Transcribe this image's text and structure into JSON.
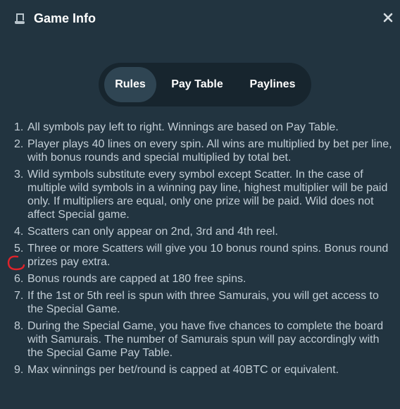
{
  "header": {
    "title": "Game Info",
    "icon": "scroll-icon",
    "close_icon": "close-icon"
  },
  "tabs": [
    {
      "label": "Rules",
      "active": true
    },
    {
      "label": "Pay Table",
      "active": false
    },
    {
      "label": "Paylines",
      "active": false
    }
  ],
  "rules": [
    {
      "num": "1.",
      "text": "All symbols pay left to right. Winnings are based on Pay Table."
    },
    {
      "num": "2.",
      "text": "Player plays 40 lines on every spin. All wins are multiplied by bet per line, with bonus rounds and special multiplied by total bet."
    },
    {
      "num": "3.",
      "text": "Wild symbols substitute every symbol except Scatter. In the case of multiple wild symbols in a winning pay line, highest multiplier will be paid only. If multipliers are equal, only one prize will be paid. Wild does not affect Special game."
    },
    {
      "num": "4.",
      "text": "Scatters can only appear on 2nd, 3rd and 4th reel."
    },
    {
      "num": "5.",
      "text": "Three or more Scatters will give you 10 bonus round spins. Bonus round prizes pay extra."
    },
    {
      "num": "6.",
      "text": "Bonus rounds are capped at 180 free spins."
    },
    {
      "num": "7.",
      "text": "If the 1st or 5th reel is spun with three Samurais, you will get access to the Special Game."
    },
    {
      "num": "8.",
      "text": "During the Special Game, you have five chances to complete the board with Samurais. The number of Samurais spun will pay accordingly with the Special Game Pay Table."
    },
    {
      "num": "9.",
      "text": "Max winnings per bet/round is capped at 40BTC or equivalent."
    }
  ],
  "colors": {
    "background": "#223440",
    "tabs_bg": "#17252e",
    "tab_active": "#2f4553",
    "highlight": "#e0232b"
  }
}
